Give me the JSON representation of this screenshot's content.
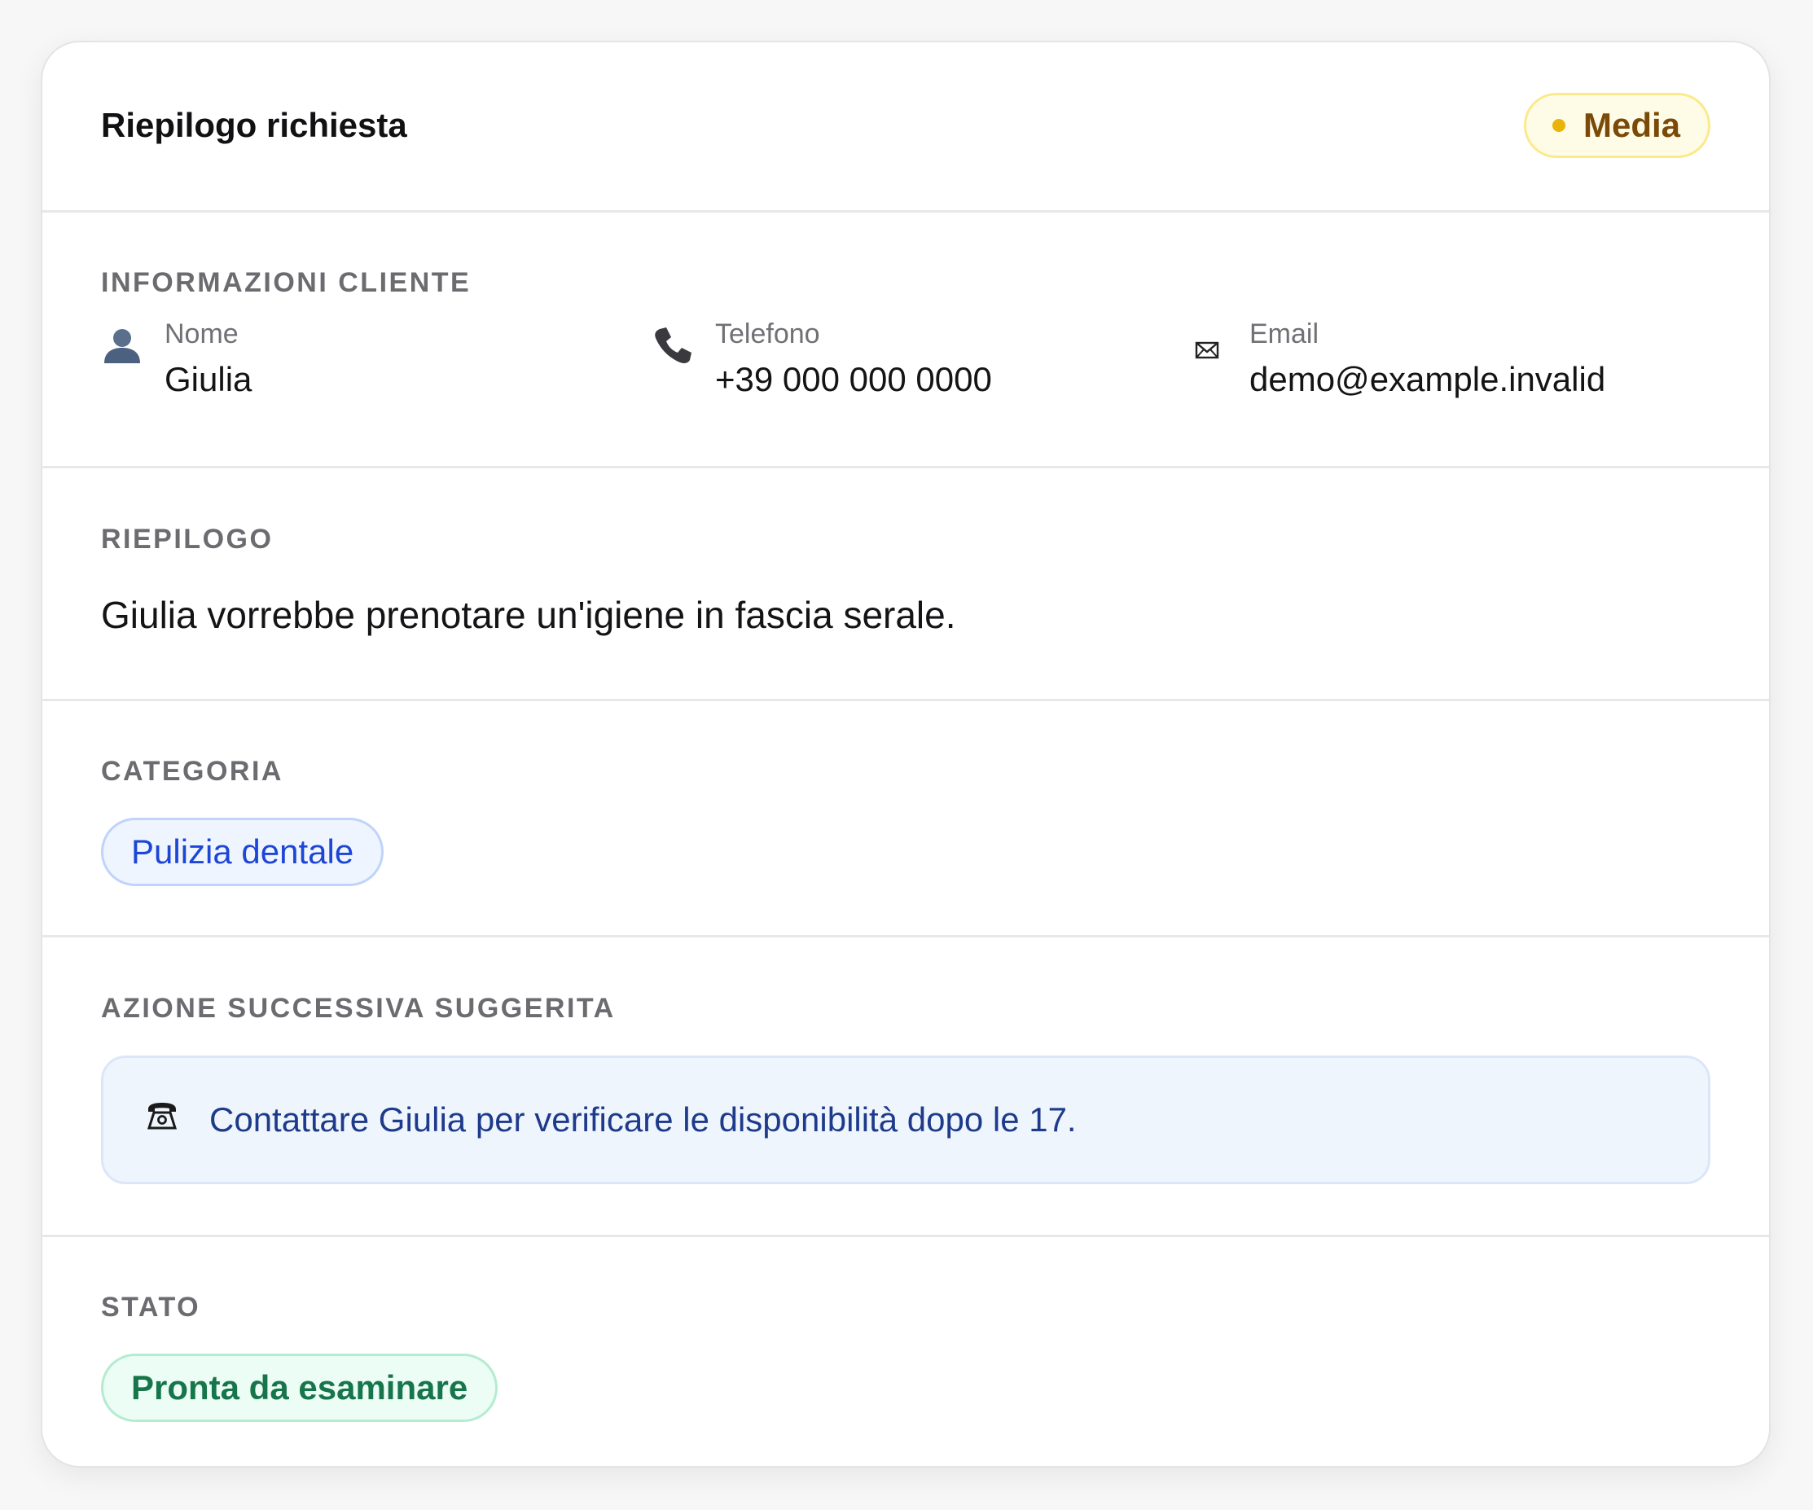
{
  "header": {
    "title": "Riepilogo richiesta",
    "priority_label": "Media",
    "priority_color": "#eab308"
  },
  "customer": {
    "section_label": "INFORMAZIONI CLIENTE",
    "name": {
      "icon": "person-icon",
      "label": "Nome",
      "value": "Giulia"
    },
    "phone": {
      "icon": "phone-icon",
      "label": "Telefono",
      "value": "+39 000 000 0000"
    },
    "email": {
      "icon": "envelope-icon",
      "label": "Email",
      "value": "demo@example.invalid"
    }
  },
  "summary": {
    "section_label": "RIEPILOGO",
    "text": "Giulia vorrebbe prenotare un'igiene in fascia serale."
  },
  "category": {
    "section_label": "CATEGORIA",
    "value": "Pulizia dentale"
  },
  "next_action": {
    "section_label": "AZIONE SUCCESSIVA SUGGERITA",
    "icon": "telephone-icon",
    "text": "Contattare Giulia per verificare le disponibilità dopo le 17."
  },
  "status": {
    "section_label": "STATO",
    "value": "Pronta da esaminare"
  },
  "colors": {
    "accent_blue": "#1d46d6",
    "action_text": "#1e3a8a",
    "status_green": "#16754a",
    "priority_text": "#7c4a08"
  }
}
